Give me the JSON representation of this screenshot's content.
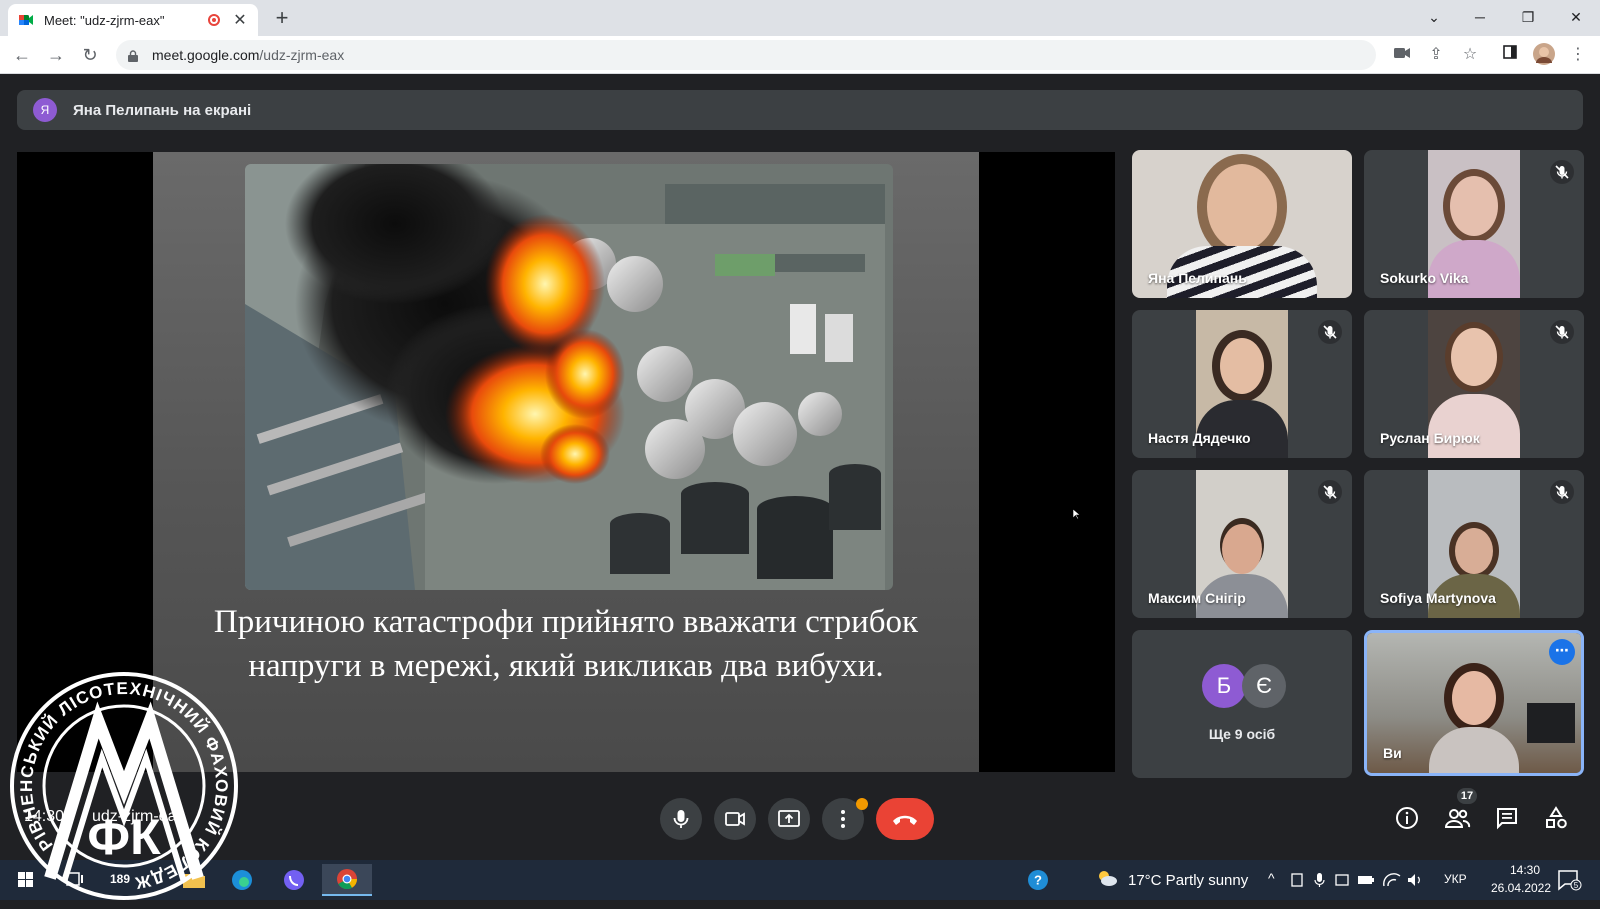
{
  "browser": {
    "tab_title": "Meet: \"udz-zjrm-eax\"",
    "url_host": "meet.google.com",
    "url_path": "/udz-zjrm-eax"
  },
  "presenter": {
    "initial": "Я",
    "text": "Яна Пелипань на екрані"
  },
  "slide": {
    "caption": "Причиною катастрофи прийнято вважати стрибок напруги в мережі, який викликав два вибухи."
  },
  "participants": [
    {
      "name": "Яна Пелипань",
      "muted": false
    },
    {
      "name": "Sokurko Vika",
      "muted": true
    },
    {
      "name": "Настя Дядечко",
      "muted": true
    },
    {
      "name": "Руслан Бирюк",
      "muted": true
    },
    {
      "name": "Максим Снігір",
      "muted": true
    },
    {
      "name": "Sofiya Martynova",
      "muted": true
    }
  ],
  "more": {
    "avatar1": "Б",
    "avatar2": "Є",
    "label": "Ще 9 осіб"
  },
  "self": {
    "name": "Ви"
  },
  "meeting": {
    "time": "14:30",
    "code": "udz-zjrm-eax",
    "people_count": "17"
  },
  "taskbar": {
    "badge": "189",
    "weather": "17°C  Partly sunny",
    "lang": "УКР",
    "time": "14:30",
    "date": "26.04.2022"
  },
  "logo": {
    "ring_text": "РІВНЕНСЬКИЙ ЛІСОТЕХНІЧНИЙ ФАХОВИЙ КОЛЕДЖ",
    "letters": "ФК"
  },
  "colors": {
    "meet_bg": "#202124",
    "tile_bg": "#3c4043",
    "hangup": "#ea4335",
    "accent": "#1a73e8"
  }
}
